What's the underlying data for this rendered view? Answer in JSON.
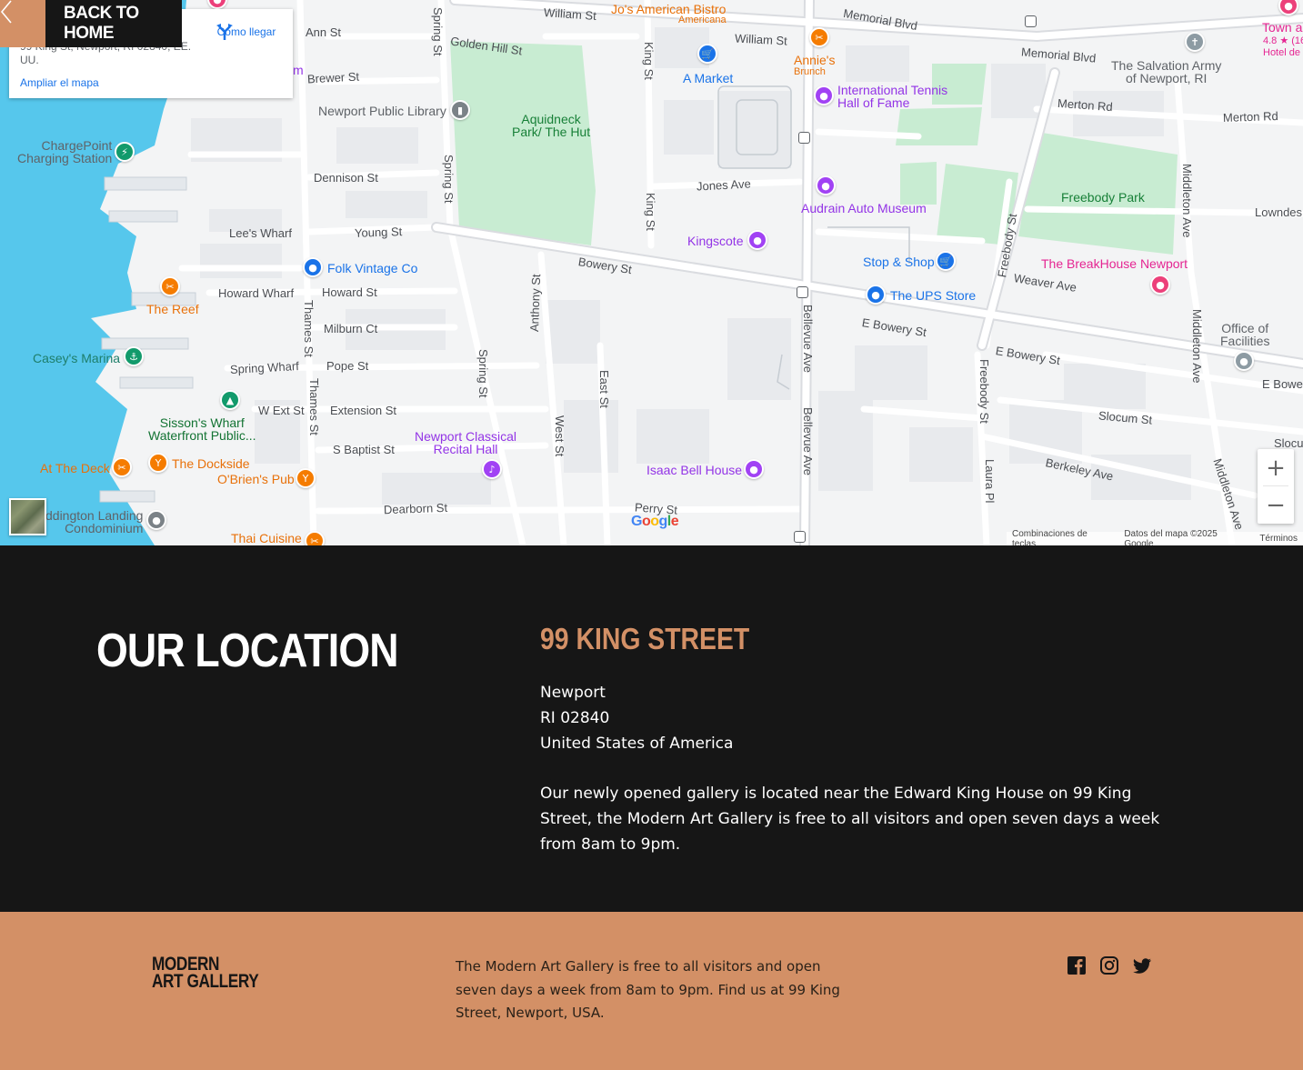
{
  "back_button": {
    "label": "BACK TO HOME"
  },
  "map": {
    "info_card": {
      "address": "99 King St, Newport, RI 02840, EE. UU.",
      "directions_label": "Cómo llegar",
      "expand_label": "Ampliar el mapa"
    },
    "streets": {
      "william_1": "William St",
      "william_2": "William St",
      "memorial_1": "Memorial Blvd",
      "memorial_2": "Memorial Blvd",
      "ann": "Ann St",
      "golden_hill": "Golden Hill St",
      "brewer": "Brewer St",
      "dennison": "Dennison St",
      "young": "Young St",
      "lees_wharf": "Lee's Wharf",
      "howard_wharf": "Howard Wharf",
      "howard": "Howard St",
      "milburn": "Milburn Ct",
      "spring_wharf": "Spring Wharf",
      "pope": "Pope St",
      "w_ext": "W Ext St",
      "extension": "Extension St",
      "s_baptist": "S Baptist St",
      "dearborn": "Dearborn St",
      "perry": "Perry St",
      "bowery": "Bowery St",
      "e_bowery_1": "E Bowery St",
      "e_bowery_2": "E Bowery St",
      "e_bowe": "E Bowe",
      "jones": "Jones Ave",
      "merton_1": "Merton Rd",
      "merton_2": "Merton Rd",
      "lowndes": "Lowndes",
      "weaver": "Weaver Ave",
      "slocum": "Slocum St",
      "slocu": "Slocu",
      "berkeley": "Berkeley Ave",
      "spring_1": "Spring St",
      "spring_2": "Spring St",
      "spring_3": "Spring St",
      "thames_1": "Thames St",
      "thames_2": "Thames St",
      "king_1": "King St",
      "king_2": "King St",
      "anthony": "Anthony St",
      "east": "East St",
      "west": "West St",
      "bellevue_1": "Bellevue Ave",
      "bellevue_2": "Bellevue Ave",
      "freebody_1": "Freebody St",
      "freebody_2": "Freebody St",
      "middleton_1": "Middleton Ave",
      "middleton_2": "Middleton Ave",
      "middleton_3": "Middleton Ave",
      "laura": "Laura Pl"
    },
    "places": {
      "jos_bistro": "Jo's American Bistro",
      "jos_bistro_sub": "Americana",
      "annies": "Annie's",
      "annies_sub": "Brunch",
      "a_market": "A Market",
      "tennis_hof": "International Tennis\nHall of Fame",
      "salvation_army": "The Salvation Army\nof Newport, RI",
      "town_a": "Town a",
      "town_rating": "4.8 ★ (16",
      "town_sub": "Hotel de",
      "newport_library": "Newport Public Library",
      "aquidneck_park": "Aquidneck\nPark/ The Hut",
      "chargepoint": "ChargePoint\nCharging Station",
      "audrain": "Audrain Auto Museum",
      "freebody_park": "Freebody Park",
      "kingscote": "Kingscote",
      "folk_vintage": "Folk Vintage Co",
      "stop_shop": "Stop & Shop",
      "breakhouse": "The BreakHouse Newport",
      "ups_store": "The UPS Store",
      "the_reef": "The Reef",
      "caseys_marina": "Casey's Marina",
      "office_facilities": "Office of\nFacilities",
      "sissons_wharf": "Sisson's Wharf\nWaterfront Public...",
      "newport_classical": "Newport Classical\nRecital Hall",
      "at_the_deck": "At The Deck",
      "the_dockside": "The Dockside",
      "obriens_pub": "O'Brien's Pub",
      "isaac_bell": "Isaac Bell House",
      "waddington": "ddington Landing\nCondominium",
      "thai_cuisine": "Thai Cuisine",
      "partial_m": "m"
    },
    "google_logo": "Google",
    "attribution": {
      "shortcuts": "Combinaciones de teclas",
      "map_data": "Datos del mapa ©2025 Google",
      "terms": "Términos"
    },
    "zoom_in": "+",
    "zoom_out": "−"
  },
  "location": {
    "heading": "OUR LOCATION",
    "street": "99 KING STREET",
    "city": "Newport",
    "state_zip": "RI 02840",
    "country": "United States of America",
    "description": "Our newly opened gallery is located near the Edward King House on 99 King Street, the Modern Art Gallery is free to all visitors and open seven days a week from 8am to 9pm."
  },
  "footer": {
    "logo_line1": "MODERN",
    "logo_line2": "ART GALLERY",
    "text": "The Modern Art Gallery is free to all visitors and open seven days a week from 8am to 9pm. Find us at 99 King Street, Newport, USA.",
    "social": [
      "facebook-icon",
      "instagram-icon",
      "twitter-icon"
    ]
  },
  "colors": {
    "accent": "#d39066",
    "dark_bg": "#161616",
    "map_water": "#4dc8e8",
    "map_park": "#c9ecd2",
    "map_road": "#ffffff"
  }
}
